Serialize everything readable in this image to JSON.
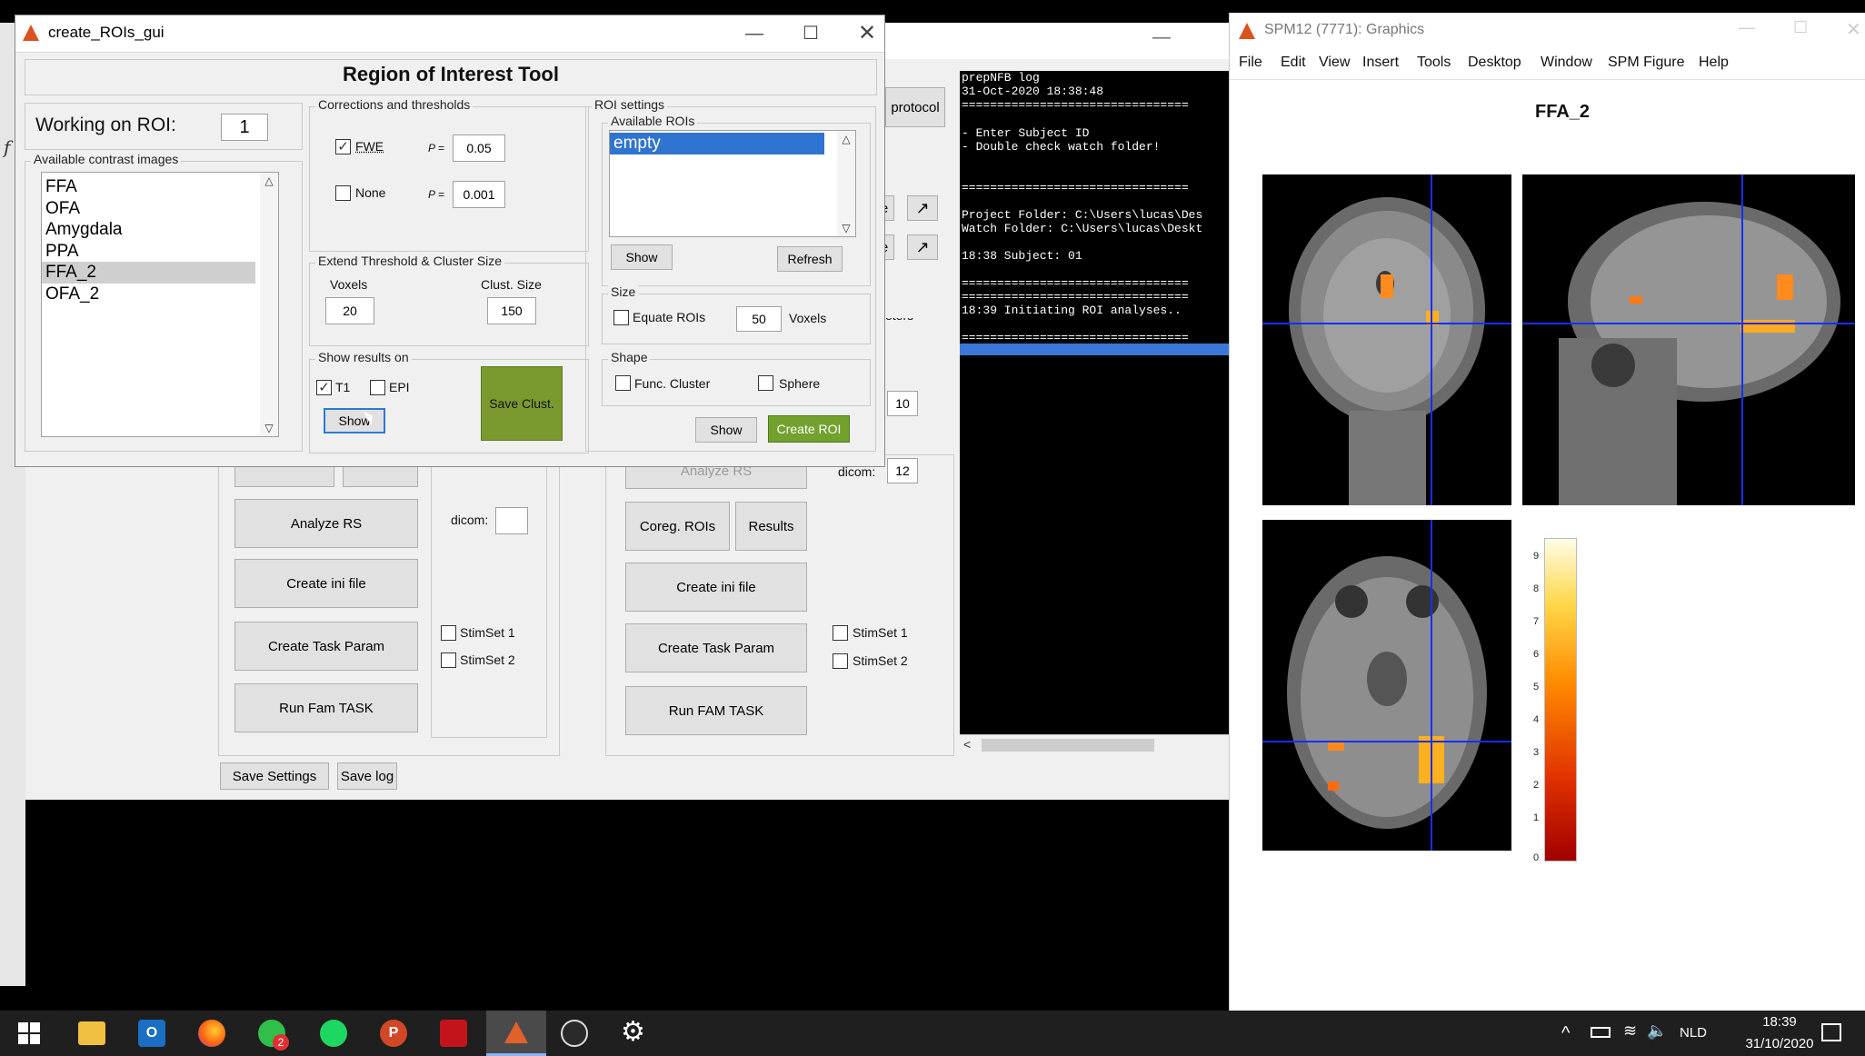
{
  "roi_window": {
    "title": "create_ROIs_gui",
    "heading": "Region of Interest Tool",
    "working_label": "Working on ROI:",
    "working_value": "1",
    "contrast_group_title": "Available contrast images",
    "contrasts": [
      "FFA",
      "OFA",
      "Amygdala",
      "PPA",
      "FFA_2",
      "OFA_2"
    ],
    "selected_contrast": "FFA_2",
    "corrections_title": "Corrections and thresholds",
    "fwe_label": "FWE",
    "fwe_checked": true,
    "none_label": "None",
    "none_checked": false,
    "p_label": "P =",
    "p_fwe": "0.05",
    "p_none": "0.001",
    "extend_title": "Extend Threshold & Cluster Size",
    "voxels_label": "Voxels",
    "voxels_value": "20",
    "clust_label": "Clust. Size",
    "clust_value": "150",
    "show_results_title": "Show results on",
    "t1_label": "T1",
    "t1_checked": true,
    "epi_label": "EPI",
    "epi_checked": false,
    "show_label": "Show",
    "save_clust_label": "Save Clust.",
    "roi_settings_title": "ROI settings",
    "available_rois_title": "Available ROIs",
    "rois": [
      "empty"
    ],
    "rois_show_label": "Show",
    "refresh_label": "Refresh",
    "size_title": "Size",
    "equate_label": "Equate ROIs",
    "size_value": "50",
    "size_unit": "Voxels",
    "shape_title": "Shape",
    "func_cluster_label": "Func. Cluster",
    "sphere_label": "Sphere",
    "show2_label": "Show",
    "create_roi_label": "Create ROI"
  },
  "main_window": {
    "protocol_label": "protocol",
    "left_buttons": [
      "Analyze RS",
      "Create ini file",
      "Create Task Param",
      "Run Fam TASK"
    ],
    "right_buttons": [
      "Create ini file",
      "Create Task Param",
      "Run FAM TASK"
    ],
    "coreg_label": "Coreg. ROIs",
    "results_label": "Results",
    "dicom_label": "dicom:",
    "dicom_left_value": "",
    "dicom_right_value": "12",
    "value_10": "10",
    "stimset1": "StimSet 1",
    "stimset2": "StimSet 2",
    "params_fragment": "eters",
    "e_fragment": "e",
    "save_settings": "Save Settings",
    "save_log": "Save log",
    "hidden_btn_text": "Analyze RS"
  },
  "console": {
    "lines": [
      "prepNFB log",
      "31-Oct-2020 18:38:48",
      "================================",
      "- Enter Subject ID",
      "- Double check watch folder!",
      "",
      "================================",
      "",
      "Project Folder: C:\\Users\\lucas\\Des",
      "Watch Folder: C:\\Users\\lucas\\Deskt",
      "",
      "18:38 Subject: 01",
      "",
      "================================",
      "================================",
      "",
      "18:39 Initiating ROI analyses..",
      "================================"
    ]
  },
  "spm_window": {
    "title": "SPM12 (7771): Graphics",
    "menu": [
      "File",
      "Edit",
      "View",
      "Insert",
      "Tools",
      "Desktop",
      "Window",
      "SPM Figure",
      "Help"
    ],
    "figure_title": "FFA_2",
    "colorbar_ticks": [
      "9",
      "8",
      "7",
      "6",
      "5",
      "4",
      "3",
      "2",
      "1",
      "0"
    ]
  },
  "taskbar": {
    "language": "NLD",
    "time": "18:39",
    "date": "31/10/2020",
    "outlook_badge": "2",
    "tray_chevron": "^"
  },
  "colors": {
    "accent_blue": "#3c78d8",
    "brand_green": "#7a9a2f",
    "taskbar_bg": "#1f1f1f"
  }
}
